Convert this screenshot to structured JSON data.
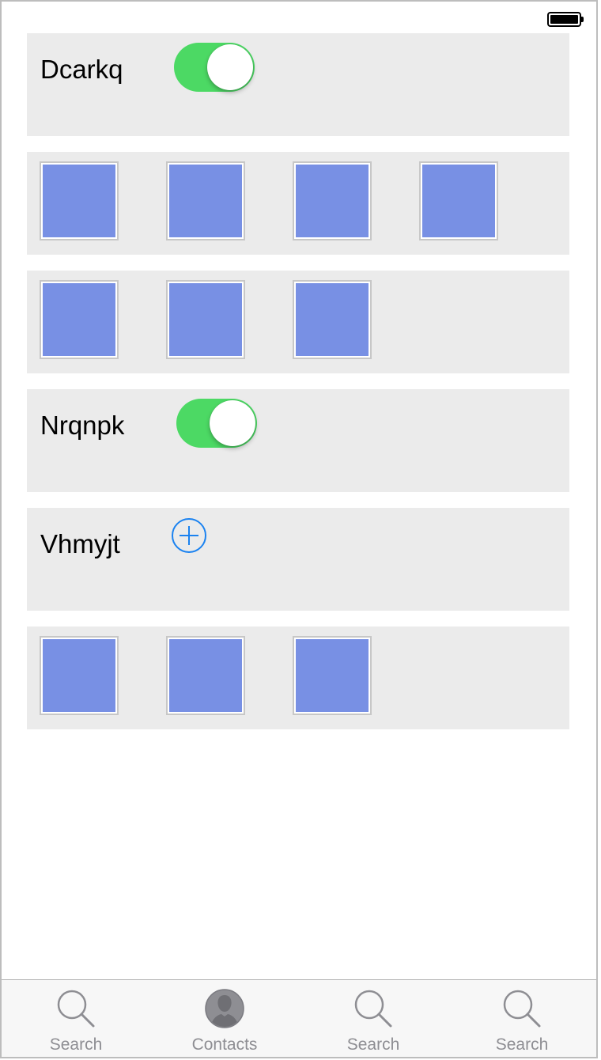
{
  "status_bar": {
    "battery_icon": "battery-full-icon"
  },
  "rows": [
    {
      "type": "toggle",
      "label": "Dcarkq",
      "toggle_on": true
    },
    {
      "type": "images",
      "image_count": 4
    },
    {
      "type": "images",
      "image_count": 3
    },
    {
      "type": "toggle",
      "label": "Nrqnpk",
      "toggle_on": true
    },
    {
      "type": "add",
      "label": "Vhmyjt",
      "icon": "add-circle-icon"
    },
    {
      "type": "images",
      "image_count": 3
    }
  ],
  "tab_bar": {
    "tabs": [
      {
        "label": "Search",
        "icon": "search-icon"
      },
      {
        "label": "Contacts",
        "icon": "contacts-icon"
      },
      {
        "label": "Search",
        "icon": "search-icon"
      },
      {
        "label": "Search",
        "icon": "search-icon"
      }
    ]
  },
  "colors": {
    "toggle_on": "#4cd964",
    "row_background": "#ebebeb",
    "image_fill": "#7890e4",
    "add_icon": "#1a82f0",
    "tab_inactive": "#8e8e93"
  }
}
